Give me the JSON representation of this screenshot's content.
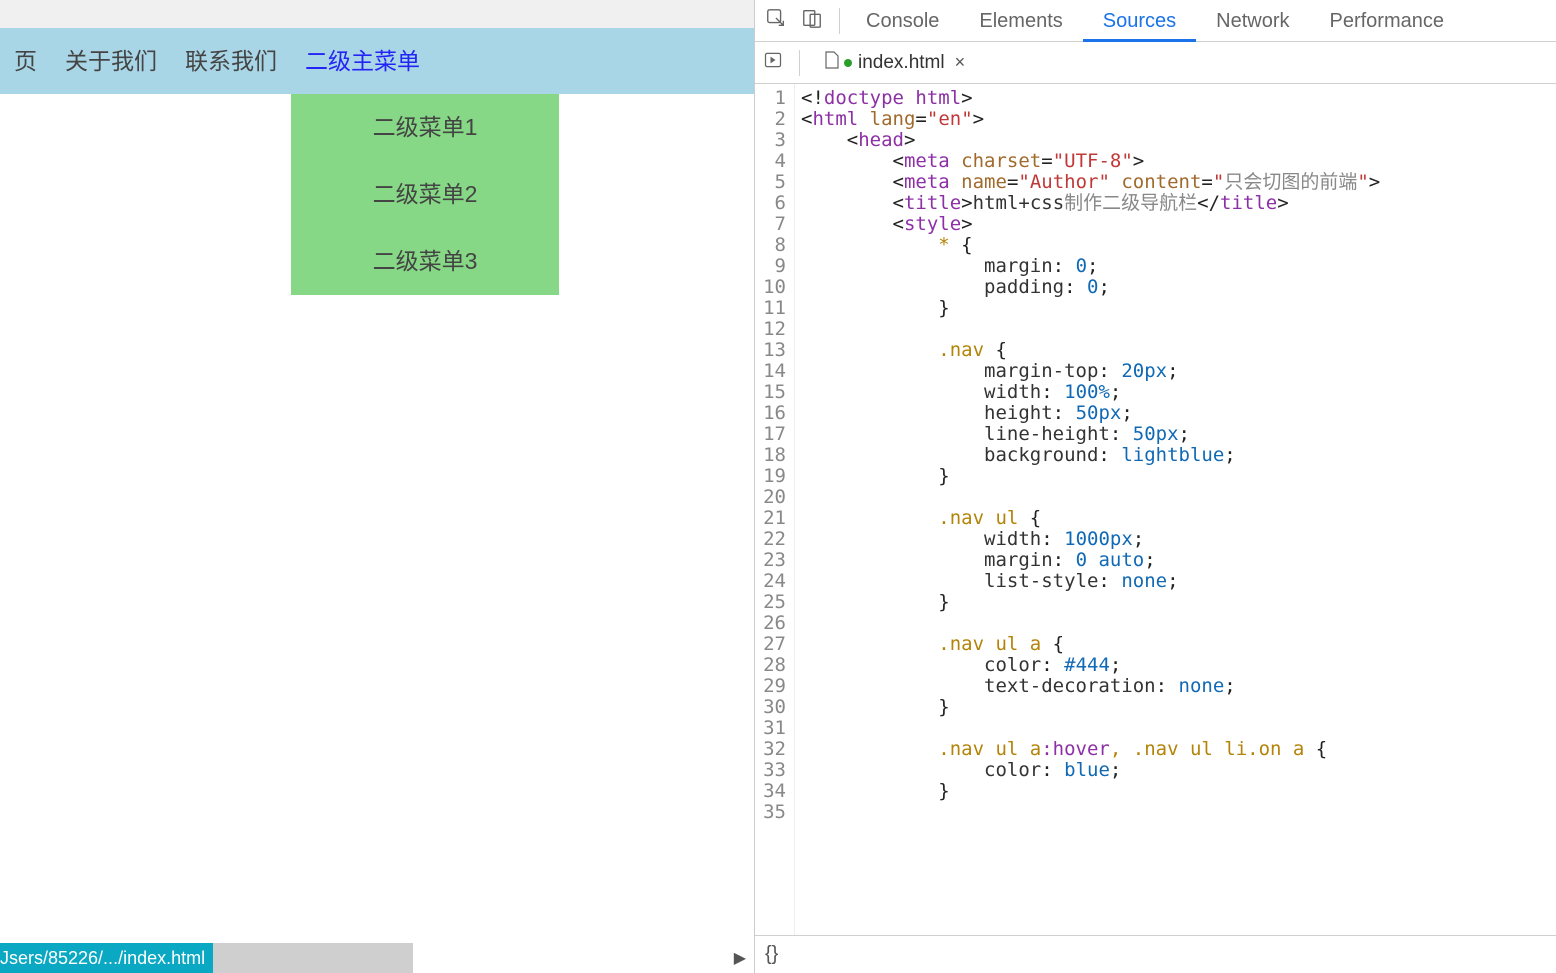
{
  "nav": {
    "items": [
      {
        "label": "页"
      },
      {
        "label": "关于我们"
      },
      {
        "label": "联系我们"
      },
      {
        "label": "二级主菜单",
        "on": true,
        "sub": [
          {
            "label": "二级菜单1"
          },
          {
            "label": "二级菜单2"
          },
          {
            "label": "二级菜单3"
          }
        ]
      }
    ]
  },
  "status": {
    "path": "Jsers/85226/.../index.html",
    "arrow": "▶"
  },
  "devtools": {
    "tabs": [
      "Console",
      "Elements",
      "Sources",
      "Network",
      "Performance"
    ],
    "active_tab": "Sources",
    "file": {
      "name": "index.html",
      "close": "×"
    },
    "bottom": "{}",
    "code_lines": [
      [
        [
          "punc",
          "<!"
        ],
        [
          "tag",
          "doctype html"
        ],
        [
          "punc",
          ">"
        ]
      ],
      [
        [
          "punc",
          "<"
        ],
        [
          "tag",
          "html "
        ],
        [
          "attr",
          "lang"
        ],
        [
          "punc",
          "="
        ],
        [
          "str",
          "\"en\""
        ],
        [
          "punc",
          ">"
        ]
      ],
      [
        [
          "pad",
          "    "
        ],
        [
          "punc",
          "<"
        ],
        [
          "tag",
          "head"
        ],
        [
          "punc",
          ">"
        ]
      ],
      [
        [
          "pad",
          "        "
        ],
        [
          "punc",
          "<"
        ],
        [
          "tag",
          "meta "
        ],
        [
          "attr",
          "charset"
        ],
        [
          "punc",
          "="
        ],
        [
          "str",
          "\"UTF-8\""
        ],
        [
          "punc",
          ">"
        ]
      ],
      [
        [
          "pad",
          "        "
        ],
        [
          "punc",
          "<"
        ],
        [
          "tag",
          "meta "
        ],
        [
          "attr",
          "name"
        ],
        [
          "punc",
          "="
        ],
        [
          "str",
          "\"Author\" "
        ],
        [
          "attr",
          "content"
        ],
        [
          "punc",
          "="
        ],
        [
          "str",
          "\""
        ],
        [
          "cjk",
          "只会切图的前端"
        ],
        [
          "str",
          "\""
        ],
        [
          "punc",
          ">"
        ]
      ],
      [
        [
          "pad",
          "        "
        ],
        [
          "punc",
          "<"
        ],
        [
          "tag",
          "title"
        ],
        [
          "punc",
          ">"
        ],
        [
          "prop",
          "html+css"
        ],
        [
          "cjk",
          "制作二级导航栏"
        ],
        [
          "punc",
          "</"
        ],
        [
          "tag",
          "title"
        ],
        [
          "punc",
          ">"
        ]
      ],
      [
        [
          "pad",
          "        "
        ],
        [
          "punc",
          "<"
        ],
        [
          "tag",
          "style"
        ],
        [
          "punc",
          ">"
        ]
      ],
      [
        [
          "pad",
          "            "
        ],
        [
          "sel",
          "* "
        ],
        [
          "punc",
          "{"
        ]
      ],
      [
        [
          "pad",
          "                "
        ],
        [
          "prop",
          "margin"
        ],
        [
          "punc",
          ": "
        ],
        [
          "val",
          "0"
        ],
        [
          "punc",
          ";"
        ]
      ],
      [
        [
          "pad",
          "                "
        ],
        [
          "prop",
          "padding"
        ],
        [
          "punc",
          ": "
        ],
        [
          "val",
          "0"
        ],
        [
          "punc",
          ";"
        ]
      ],
      [
        [
          "pad",
          "            "
        ],
        [
          "punc",
          "}"
        ]
      ],
      [
        [
          "pad",
          ""
        ]
      ],
      [
        [
          "pad",
          "            "
        ],
        [
          "sel",
          ".nav "
        ],
        [
          "punc",
          "{"
        ]
      ],
      [
        [
          "pad",
          "                "
        ],
        [
          "prop",
          "margin-top"
        ],
        [
          "punc",
          ": "
        ],
        [
          "val",
          "20px"
        ],
        [
          "punc",
          ";"
        ]
      ],
      [
        [
          "pad",
          "                "
        ],
        [
          "prop",
          "width"
        ],
        [
          "punc",
          ": "
        ],
        [
          "val",
          "100%"
        ],
        [
          "punc",
          ";"
        ]
      ],
      [
        [
          "pad",
          "                "
        ],
        [
          "prop",
          "height"
        ],
        [
          "punc",
          ": "
        ],
        [
          "val",
          "50px"
        ],
        [
          "punc",
          ";"
        ]
      ],
      [
        [
          "pad",
          "                "
        ],
        [
          "prop",
          "line-height"
        ],
        [
          "punc",
          ": "
        ],
        [
          "val",
          "50px"
        ],
        [
          "punc",
          ";"
        ]
      ],
      [
        [
          "pad",
          "                "
        ],
        [
          "prop",
          "background"
        ],
        [
          "punc",
          ": "
        ],
        [
          "val",
          "lightblue"
        ],
        [
          "punc",
          ";"
        ]
      ],
      [
        [
          "pad",
          "            "
        ],
        [
          "punc",
          "}"
        ]
      ],
      [
        [
          "pad",
          ""
        ]
      ],
      [
        [
          "pad",
          "            "
        ],
        [
          "sel",
          ".nav ul "
        ],
        [
          "punc",
          "{"
        ]
      ],
      [
        [
          "pad",
          "                "
        ],
        [
          "prop",
          "width"
        ],
        [
          "punc",
          ": "
        ],
        [
          "val",
          "1000px"
        ],
        [
          "punc",
          ";"
        ]
      ],
      [
        [
          "pad",
          "                "
        ],
        [
          "prop",
          "margin"
        ],
        [
          "punc",
          ": "
        ],
        [
          "val",
          "0 auto"
        ],
        [
          "punc",
          ";"
        ]
      ],
      [
        [
          "pad",
          "                "
        ],
        [
          "prop",
          "list-style"
        ],
        [
          "punc",
          ": "
        ],
        [
          "val",
          "none"
        ],
        [
          "punc",
          ";"
        ]
      ],
      [
        [
          "pad",
          "            "
        ],
        [
          "punc",
          "}"
        ]
      ],
      [
        [
          "pad",
          ""
        ]
      ],
      [
        [
          "pad",
          "            "
        ],
        [
          "sel",
          ".nav ul a "
        ],
        [
          "punc",
          "{"
        ]
      ],
      [
        [
          "pad",
          "                "
        ],
        [
          "prop",
          "color"
        ],
        [
          "punc",
          ": "
        ],
        [
          "val",
          "#444"
        ],
        [
          "punc",
          ";"
        ]
      ],
      [
        [
          "pad",
          "                "
        ],
        [
          "prop",
          "text-decoration"
        ],
        [
          "punc",
          ": "
        ],
        [
          "val",
          "none"
        ],
        [
          "punc",
          ";"
        ]
      ],
      [
        [
          "pad",
          "            "
        ],
        [
          "punc",
          "}"
        ]
      ],
      [
        [
          "pad",
          ""
        ]
      ],
      [
        [
          "pad",
          "            "
        ],
        [
          "sel",
          ".nav ul a"
        ],
        [
          "kw",
          ":hover"
        ],
        [
          "sel",
          ", .nav ul li.on a "
        ],
        [
          "punc",
          "{"
        ]
      ],
      [
        [
          "pad",
          "                "
        ],
        [
          "prop",
          "color"
        ],
        [
          "punc",
          ": "
        ],
        [
          "val",
          "blue"
        ],
        [
          "punc",
          ";"
        ]
      ],
      [
        [
          "pad",
          "            "
        ],
        [
          "punc",
          "}"
        ]
      ],
      [
        [
          "pad",
          ""
        ]
      ]
    ]
  }
}
